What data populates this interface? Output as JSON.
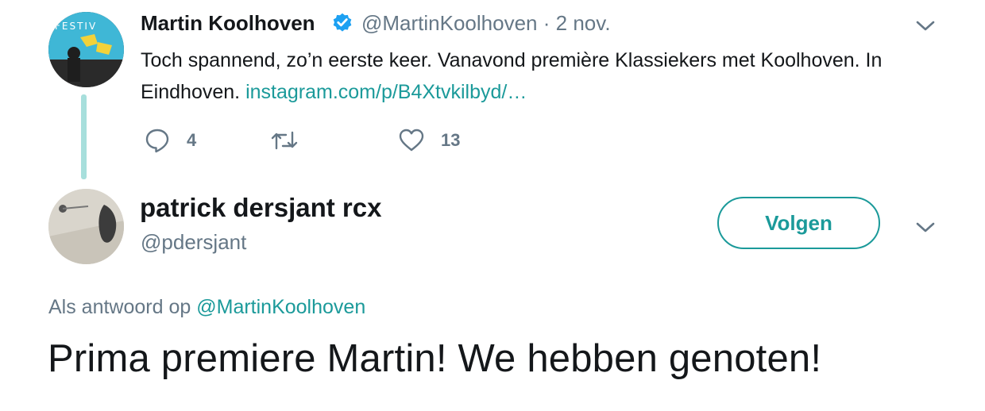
{
  "colors": {
    "accent": "#1b9a9a",
    "secondary_text": "#657786",
    "primary_text": "#14171a",
    "thread_line": "#a7dfdc"
  },
  "parent_tweet": {
    "author_name": "Martin Koolhoven",
    "verified_icon": "verified-badge-icon",
    "handle": "@MartinKoolhoven",
    "separator": "·",
    "date": "2 nov.",
    "avatar_text": "FESTIV",
    "text_before_link": "Toch spannend, zo’n eerste keer. Vanavond première Klassiekers met Koolhoven. In Eindhoven.",
    "link": "instagram.com/p/B4Xtvkilbyd/…",
    "actions": {
      "reply": {
        "icon": "reply-icon",
        "count": "4"
      },
      "retweet": {
        "icon": "retweet-icon",
        "count": ""
      },
      "like": {
        "icon": "heart-icon",
        "count": "13"
      }
    },
    "menu_icon": "chevron-down-icon"
  },
  "reply_tweet": {
    "author_name": "patrick dersjant rcx",
    "handle": "@pdersjant",
    "follow_label": "Volgen",
    "menu_icon": "chevron-down-icon",
    "reply_to_prefix": "Als antwoord op",
    "reply_to_handle": "@MartinKoolhoven",
    "text": "Prima premiere Martin! We hebben genoten!"
  }
}
